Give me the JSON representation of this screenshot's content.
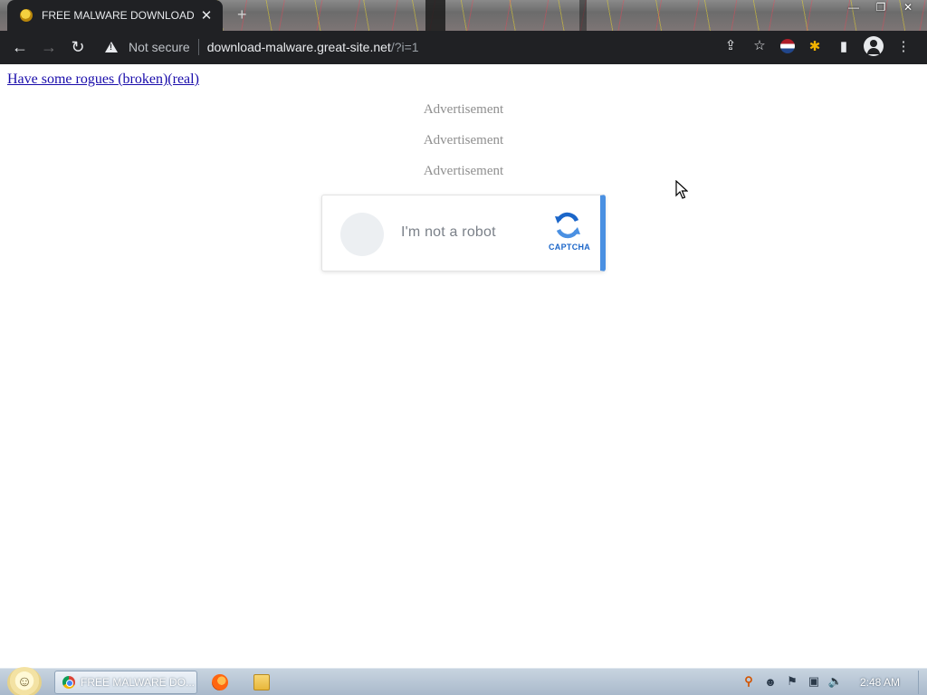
{
  "browser": {
    "tab": {
      "title": "FREE MALWARE DOWNLOAD",
      "close_label": "✕"
    },
    "new_tab_label": "+",
    "window_controls": {
      "minimize": "—",
      "restore": "❐",
      "close": "✕"
    },
    "nav": {
      "back": "←",
      "forward": "→",
      "reload": "↻"
    },
    "omnibox": {
      "security_label": "Not secure",
      "url_host": "download-malware.great-site.net",
      "url_path": "/?i=1",
      "share_icon": "⇪",
      "bookmark_icon": "☆"
    },
    "extensions": {
      "puzzle_icon": "✱",
      "sidepanel_icon": "▮",
      "menu_icon": "⋮"
    }
  },
  "page": {
    "top_link": {
      "prefix": "Have some rogues ",
      "broken": "(broken)",
      "real": "(real)"
    },
    "ads": [
      "Advertisement",
      "Advertisement",
      "Advertisement"
    ],
    "captcha": {
      "label": "I'm not a robot",
      "brand": "CAPTCHA",
      "accent_color": "#4a90e2"
    }
  },
  "taskbar": {
    "start_icon": "☺",
    "task_label": "FREE MALWARE DO...",
    "tray_icons": [
      "search-tray-icon",
      "emoji-tray-icon",
      "flag-tray-icon",
      "network-tray-icon",
      "volume-tray-icon"
    ],
    "clock": "2:48 AM"
  }
}
